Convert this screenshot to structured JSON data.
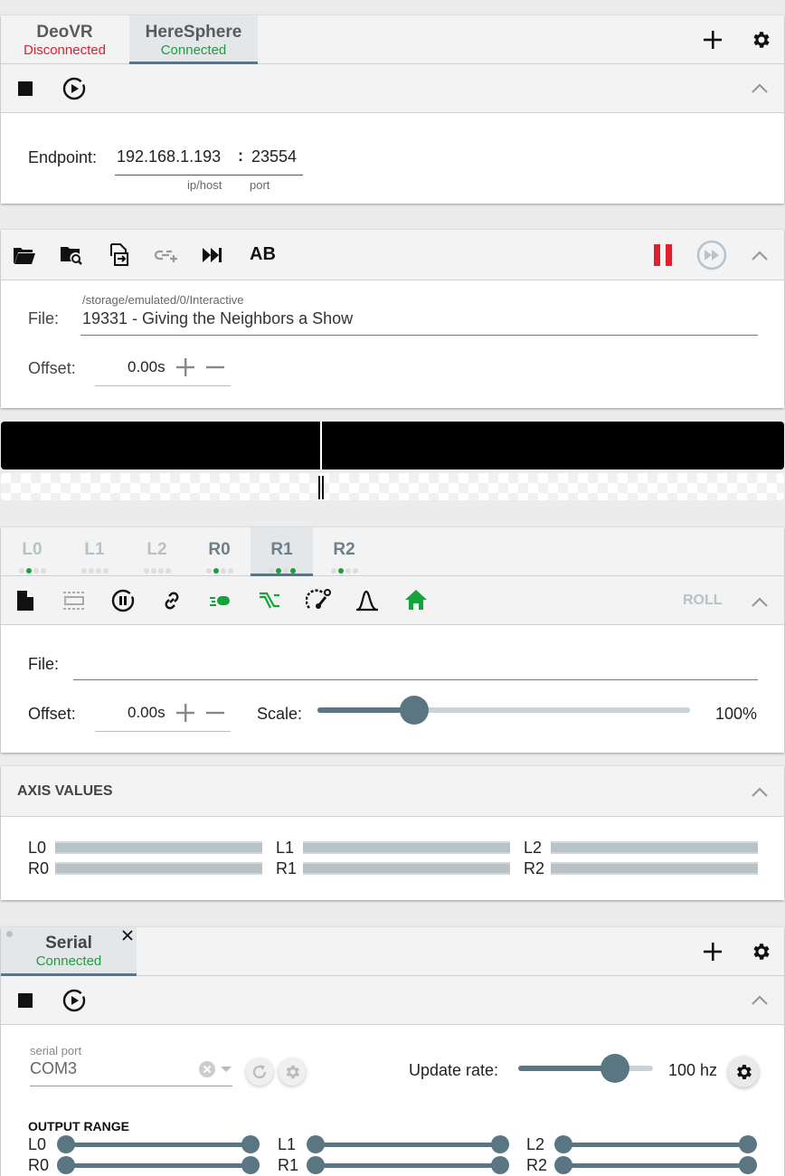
{
  "top_tabs": [
    {
      "label": "DeoVR",
      "status": "Disconnected",
      "status_color": "#e0202f"
    },
    {
      "label": "HereSphere",
      "status": "Connected",
      "status_color": "#1f9d3a"
    }
  ],
  "endpoint": {
    "label": "Endpoint:",
    "host": "192.168.1.193",
    "separator": ":",
    "port": "23554",
    "host_hint": "ip/host",
    "port_hint": "port"
  },
  "media": {
    "toolbar_ab_label": "AB",
    "file_path": "/storage/emulated/0/Interactive",
    "file_label": "File:",
    "file_name": "19331 - Giving the Neighbors a Show",
    "offset_label": "Offset:",
    "offset_value": "0.00s"
  },
  "axis_tabs": [
    {
      "label": "L0",
      "dots": [
        false,
        true,
        false,
        false
      ]
    },
    {
      "label": "L1",
      "dots": [
        false,
        false,
        false,
        false
      ]
    },
    {
      "label": "L2",
      "dots": [
        false,
        false,
        false,
        false
      ]
    },
    {
      "label": "R0",
      "dots": [
        false,
        true,
        false,
        false
      ]
    },
    {
      "label": "R1",
      "dots": [
        false,
        true,
        false,
        true
      ]
    },
    {
      "label": "R2",
      "dots": [
        false,
        true,
        false,
        false
      ]
    }
  ],
  "axis_panel": {
    "mode_label": "ROLL",
    "file_label": "File:",
    "file_value": "",
    "offset_label": "Offset:",
    "offset_value": "0.00s",
    "scale_label": "Scale:",
    "scale_value": "100%",
    "scale_fraction": 0.26
  },
  "axis_values": {
    "title": "AXIS VALUES",
    "axes": [
      "L0",
      "L1",
      "L2",
      "R0",
      "R1",
      "R2"
    ]
  },
  "serial": {
    "tab_label": "Serial",
    "tab_status": "Connected",
    "status_color": "#1f9d3a",
    "port_hint": "serial port",
    "port_value": "COM3",
    "update_rate_label": "Update rate:",
    "update_rate_value": "100 hz",
    "update_rate_fraction": 0.72,
    "output_range_title": "OUTPUT RANGE",
    "axes": [
      "L0",
      "L1",
      "L2",
      "R0",
      "R1",
      "R2"
    ]
  },
  "colors": {
    "accent": "#5b7683",
    "pause_red": "#e0202f",
    "green": "#1f9d3a",
    "icon_green": "#14a33a"
  }
}
